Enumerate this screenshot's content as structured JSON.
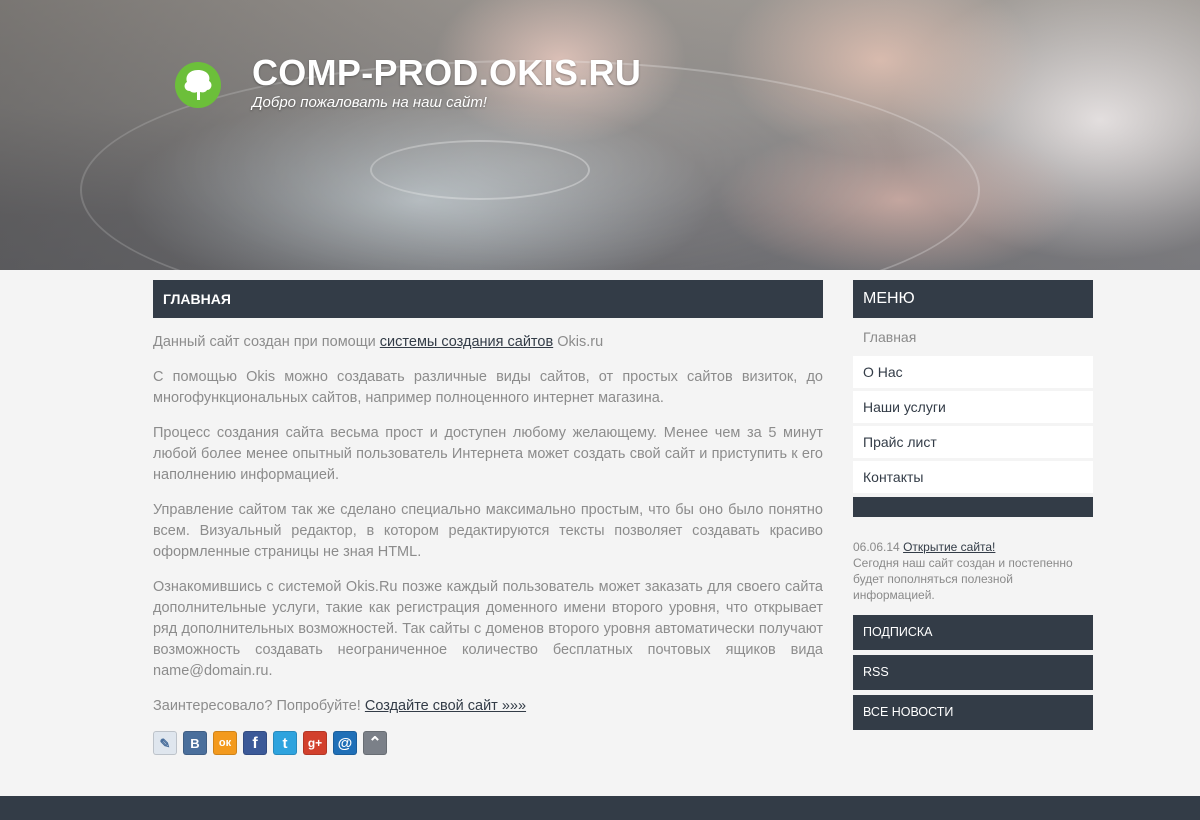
{
  "header": {
    "site_title": "COMP-PROD.OKIS.RU",
    "slogan": "Добро пожаловать на наш сайт!"
  },
  "main": {
    "title": "ГЛАВНАЯ",
    "p1_before": "Данный сайт создан при помощи ",
    "p1_link": "системы создания сайтов",
    "p1_after": " Okis.ru",
    "p2": "С помощью Okis можно создавать различные виды сайтов, от простых сайтов визиток, до многофункциональных сайтов, например полноценного интернет магазина.",
    "p3": "Процесс создания сайта весьма прост и доступен любому желающему. Менее чем за 5 минут любой более менее опытный пользователь Интернета может создать свой сайт и приступить к его наполнению информацией.",
    "p4": "Управление сайтом так же сделано специально максимально простым, что бы оно было понятно всем. Визуальный редактор, в котором редактируются тексты позволяет создавать красиво оформленные страницы не зная HTML.",
    "p5": "Ознакомившись с системой Okis.Ru позже каждый пользователь может заказать для своего сайта дополнительные услуги, такие как регистрация доменного имени второго уровня, что открывает ряд дополнительных возможностей. Так сайты с доменов второго уровня автоматически получают возможность создавать неограниченное количество бесплатных почтовых ящиков вида name@domain.ru.",
    "p6_before": "Заинтересовало? Попробуйте! ",
    "p6_link": "Создайте свой сайт »»»",
    "share_icons": [
      {
        "name": "livejournal-icon",
        "glyph": "✎",
        "color": "#dfe6ee"
      },
      {
        "name": "vkontakte-icon",
        "glyph": "B",
        "color": "#4a6f9c"
      },
      {
        "name": "odnoklassniki-icon",
        "glyph": "ок",
        "color": "#f39a1e"
      },
      {
        "name": "facebook-icon",
        "glyph": "f",
        "color": "#3b5998"
      },
      {
        "name": "twitter-icon",
        "glyph": "t",
        "color": "#2ea3de"
      },
      {
        "name": "googleplus-icon",
        "glyph": "g+",
        "color": "#d2402c"
      },
      {
        "name": "mailru-icon",
        "glyph": "@",
        "color": "#1f6fb7"
      },
      {
        "name": "scroll-up-icon",
        "glyph": "⌃",
        "color": "#7b8088"
      }
    ]
  },
  "sidebar": {
    "menu_title": "МЕНЮ",
    "items": [
      {
        "label": "Главная"
      },
      {
        "label": "О Нас"
      },
      {
        "label": "Наши услуги"
      },
      {
        "label": "Прайс лист"
      },
      {
        "label": "Контакты"
      }
    ],
    "news": {
      "date": "06.06.14",
      "title": "Открытие сайта!",
      "text": "Сегодня наш сайт создан и постепенно будет пополняться полезной информацией."
    },
    "blocks": [
      "ПОДПИСКА",
      "RSS",
      "ВСЕ НОВОСТИ"
    ]
  },
  "colors": {
    "dark": "#333c47",
    "background": "#f4f4f4",
    "logo_green": "#6cbf3a"
  }
}
